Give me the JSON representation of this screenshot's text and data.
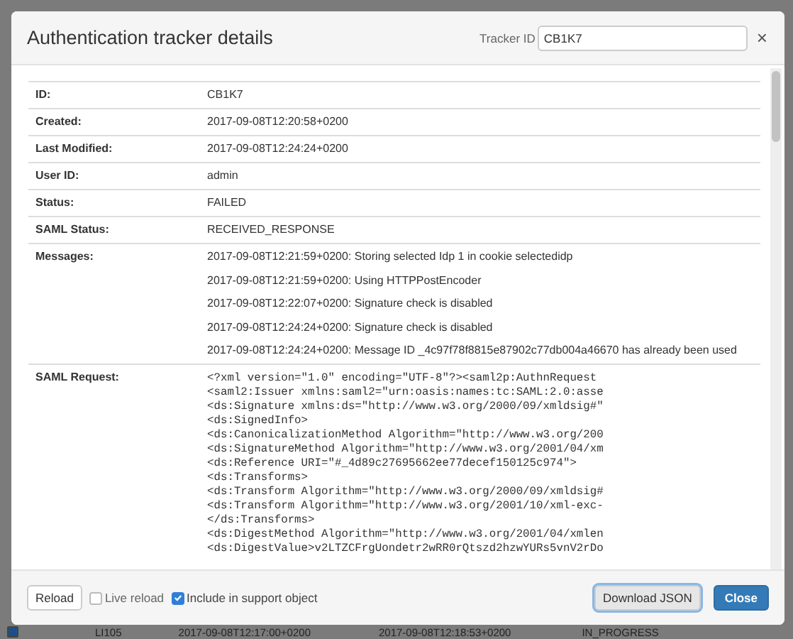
{
  "header": {
    "title": "Authentication tracker details",
    "tracker_label": "Tracker ID",
    "tracker_value": "CB1K7",
    "close": "×"
  },
  "details": [
    {
      "kind": "text",
      "label": "ID:",
      "value": "CB1K7"
    },
    {
      "kind": "text",
      "label": "Created:",
      "value": "2017-09-08T12:20:58+0200"
    },
    {
      "kind": "text",
      "label": "Last Modified:",
      "value": "2017-09-08T12:24:24+0200"
    },
    {
      "kind": "text",
      "label": "User ID:",
      "value": "admin"
    },
    {
      "kind": "text",
      "label": "Status:",
      "value": "FAILED"
    },
    {
      "kind": "text",
      "label": "SAML Status:",
      "value": "RECEIVED_RESPONSE"
    },
    {
      "kind": "list",
      "label": "Messages:",
      "lines": [
        "2017-09-08T12:21:59+0200: Storing selected Idp 1 in cookie selectedidp",
        "2017-09-08T12:21:59+0200: Using HTTPPostEncoder",
        "2017-09-08T12:22:07+0200: Signature check is disabled",
        "2017-09-08T12:24:24+0200: Signature check is disabled",
        "2017-09-08T12:24:24+0200: Message ID _4c97f78f8815e87902c77db004a46670 has already been used"
      ]
    },
    {
      "kind": "code",
      "label": "SAML Request:",
      "lines": [
        "<?xml version=\"1.0\" encoding=\"UTF-8\"?><saml2p:AuthnRequest",
        "<saml2:Issuer xmlns:saml2=\"urn:oasis:names:tc:SAML:2.0:asse",
        "<ds:Signature xmlns:ds=\"http://www.w3.org/2000/09/xmldsig#\"",
        "<ds:SignedInfo>",
        "<ds:CanonicalizationMethod Algorithm=\"http://www.w3.org/200",
        "<ds:SignatureMethod Algorithm=\"http://www.w3.org/2001/04/xm",
        "<ds:Reference URI=\"#_4d89c27695662ee77decef150125c974\">",
        "<ds:Transforms>",
        "<ds:Transform Algorithm=\"http://www.w3.org/2000/09/xmldsig#",
        "<ds:Transform Algorithm=\"http://www.w3.org/2001/10/xml-exc-",
        "</ds:Transforms>",
        "<ds:DigestMethod Algorithm=\"http://www.w3.org/2001/04/xmlen",
        "<ds:DigestValue>v2LTZCFrgUondetr2wRR0rQtszd2hzwYURs5vnV2rDo"
      ]
    }
  ],
  "footer": {
    "reload": "Reload",
    "checkboxes": [
      {
        "label": "Live reload",
        "checked": false
      },
      {
        "label": "Include in support object",
        "checked": true
      }
    ],
    "buttons": [
      {
        "label": "Download JSON",
        "kind": "default",
        "focused": true
      },
      {
        "label": "Close",
        "kind": "primary",
        "focused": false
      }
    ]
  },
  "background_row": {
    "checked": true,
    "cells": [
      "LI105",
      "2017-09-08T12:17:00+0200",
      "2017-09-08T12:18:53+0200",
      "IN_PROGRESS"
    ]
  }
}
